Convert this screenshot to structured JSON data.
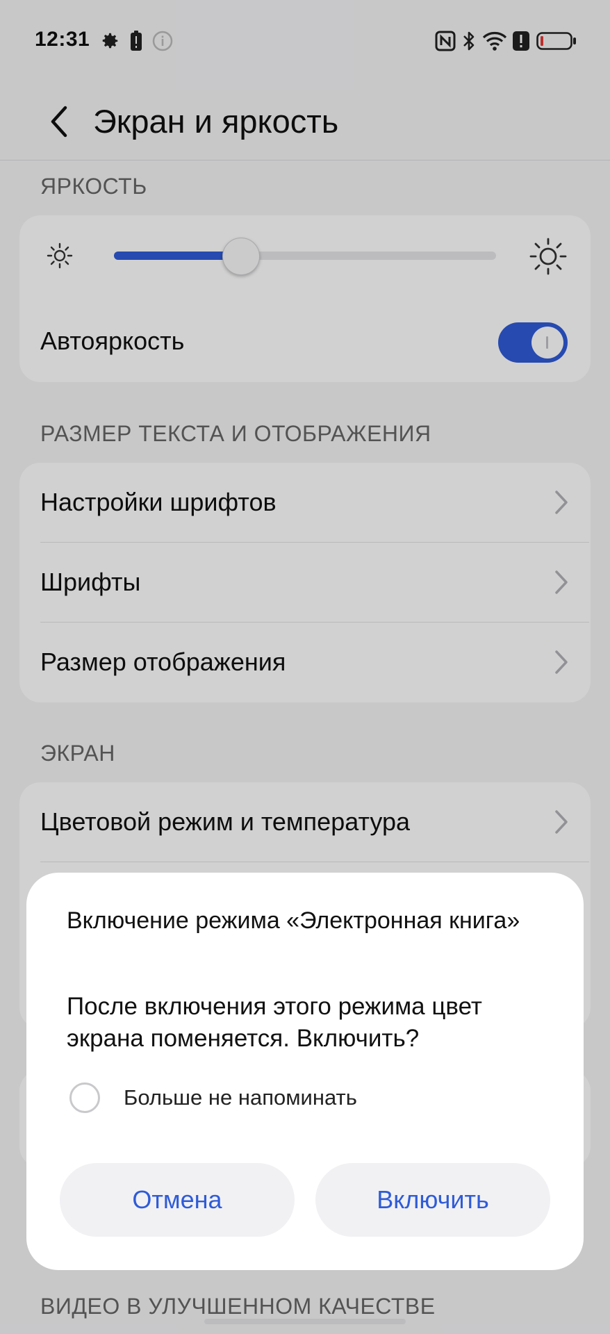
{
  "status_bar": {
    "time": "12:31"
  },
  "header": {
    "title": "Экран и яркость"
  },
  "sections": {
    "brightness": "ЯРКОСТЬ",
    "text_size": "РАЗМЕР ТЕКСТА И ОТОБРАЖЕНИЯ",
    "screen": "ЭКРАН",
    "video": "ВИДЕО В УЛУЧШЕННОМ КАЧЕСТВЕ"
  },
  "brightness": {
    "level": 0.3,
    "auto_label": "Автояркость",
    "auto_enabled": true
  },
  "text_items": [
    {
      "label": "Настройки шрифтов"
    },
    {
      "label": "Шрифты"
    },
    {
      "label": "Размер отображения"
    }
  ],
  "screen_items": [
    {
      "label": "Цветовой режим и температура"
    }
  ],
  "dialog": {
    "title": "Включение режима «Электронная книга»",
    "message": "После включения этого режима цвет экрана поменяется. Включить?",
    "checkbox_label": "Больше не напоминать",
    "cancel_label": "Отмена",
    "confirm_label": "Включить"
  },
  "colors": {
    "accent": "#2f5bd7",
    "background": "#f4f4f6",
    "card": "#ffffff"
  }
}
